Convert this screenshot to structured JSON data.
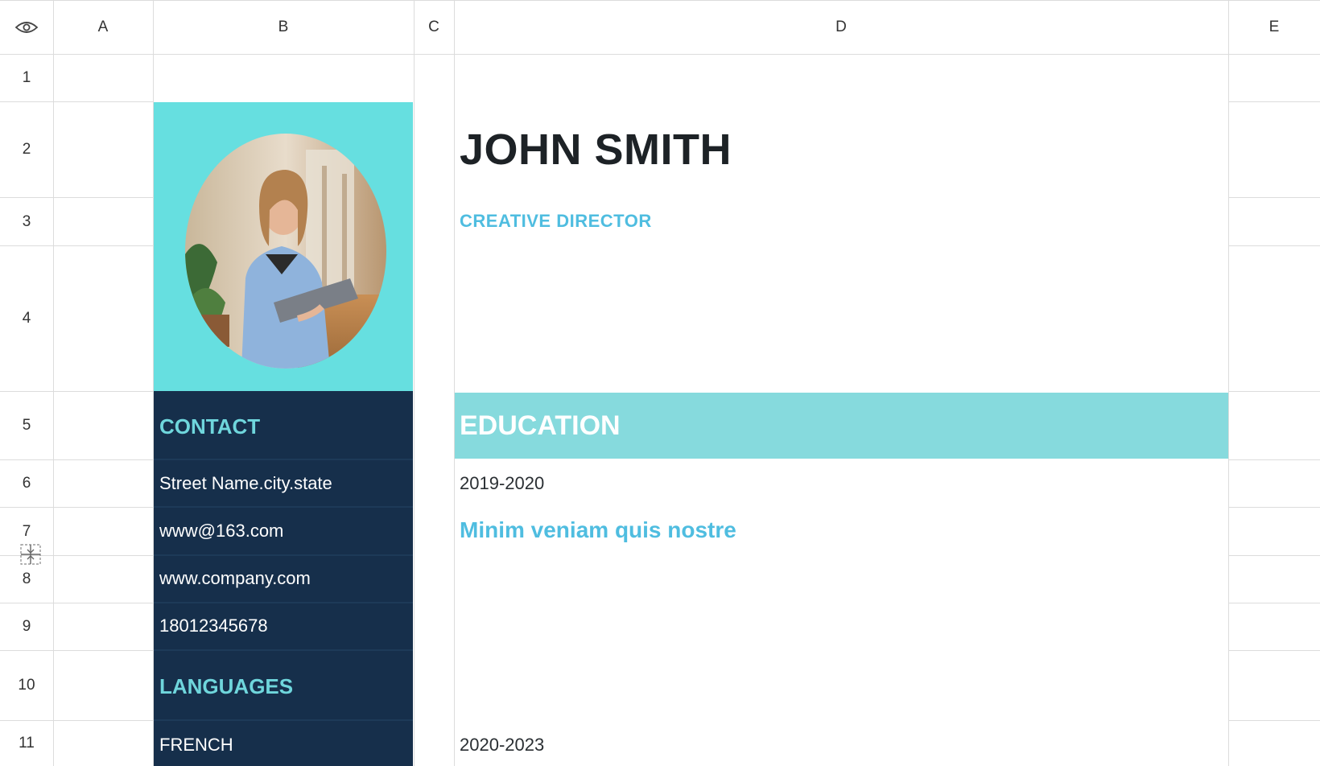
{
  "columns": [
    "A",
    "B",
    "C",
    "D",
    "E"
  ],
  "rows": [
    "1",
    "2",
    "3",
    "4",
    "5",
    "6",
    "7",
    "8",
    "9",
    "10",
    "11"
  ],
  "icons": {
    "header_corner": "eye-icon",
    "row_resize": "row-resize-icon"
  },
  "colors": {
    "sidebar_top": "#66dfe0",
    "sidebar": "#162f4b",
    "section_band": "#86dadd",
    "accent": "#4fbde0",
    "sidebar_heading": "#6fd6dc"
  },
  "resume": {
    "name": "JOHN SMITH",
    "title": "CREATIVE DIRECTOR",
    "contact": {
      "heading": "CONTACT",
      "address": "Street Name.city.state",
      "email": "www@163.com",
      "website": "www.company.com",
      "phone": "18012345678"
    },
    "languages": {
      "heading": "LANGUAGES",
      "items": [
        "FRENCH"
      ]
    },
    "education": {
      "heading": "EDUCATION",
      "entries": [
        {
          "period": "2019-2020",
          "subtitle": "Minim veniam quis nostre"
        },
        {
          "period": "2020-2023"
        }
      ]
    }
  }
}
